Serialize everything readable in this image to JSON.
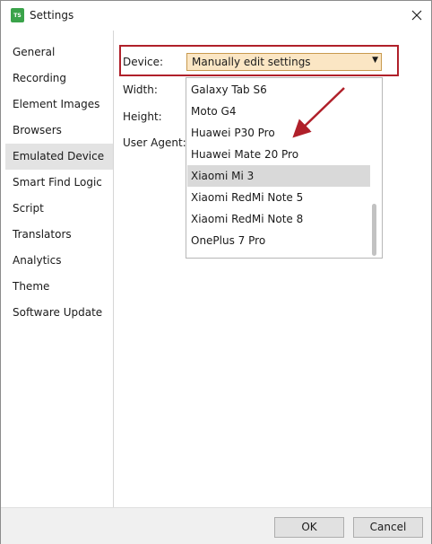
{
  "window": {
    "title": "Settings",
    "icon_text": "TS"
  },
  "sidebar": {
    "items": [
      {
        "label": "General"
      },
      {
        "label": "Recording"
      },
      {
        "label": "Element Images"
      },
      {
        "label": "Browsers"
      },
      {
        "label": "Emulated Device",
        "selected": true
      },
      {
        "label": "Smart Find Logic"
      },
      {
        "label": "Script"
      },
      {
        "label": "Translators"
      },
      {
        "label": "Analytics"
      },
      {
        "label": "Theme"
      },
      {
        "label": "Software Update"
      }
    ]
  },
  "form": {
    "device_label": "Device:",
    "device_value": "Manually edit settings",
    "width_label": "Width:",
    "height_label": "Height:",
    "user_agent_label": "User Agent:"
  },
  "dropdown": {
    "options": [
      "Galaxy Tab S6",
      "Moto G4",
      "Huawei P30 Pro",
      "Huawei Mate 20 Pro",
      "Xiaomi Mi 3",
      "Xiaomi RedMi Note 5",
      "Xiaomi RedMi Note 8",
      "OnePlus 7 Pro"
    ],
    "highlighted": "Xiaomi Mi 3"
  },
  "footer": {
    "ok_label": "OK",
    "cancel_label": "Cancel"
  },
  "colors": {
    "annotation": "#b0202a",
    "combo_bg": "#fbe6c4",
    "selection": "#e3e3e3"
  }
}
